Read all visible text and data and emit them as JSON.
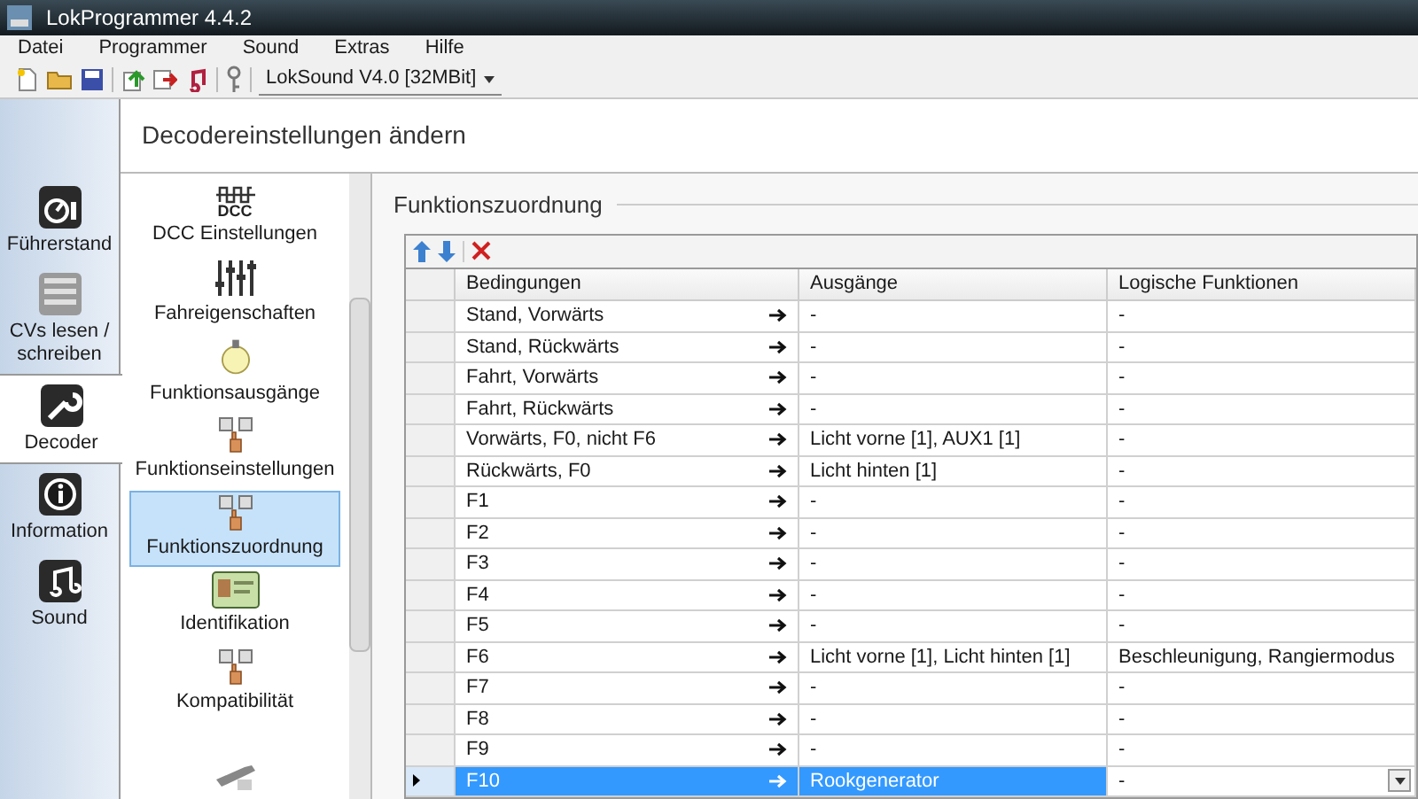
{
  "window": {
    "title": "LokProgrammer 4.4.2"
  },
  "menu": [
    "Datei",
    "Programmer",
    "Sound",
    "Extras",
    "Hilfe"
  ],
  "toolbar": {
    "decoder_select": "LokSound V4.0 [32MBit]"
  },
  "nav": [
    {
      "label": "Führerstand",
      "kind": "gauge",
      "selected": false
    },
    {
      "label": "CVs lesen / schreiben",
      "kind": "binary",
      "selected": false
    },
    {
      "label": "Decoder",
      "kind": "wrench",
      "selected": true
    },
    {
      "label": "Information",
      "kind": "info",
      "selected": false
    },
    {
      "label": "Sound",
      "kind": "music",
      "selected": false
    }
  ],
  "page_title": "Decodereinstellungen ändern",
  "sections": [
    {
      "label": "DCC Einstellungen",
      "kind": "dcc",
      "icon_text": "DCC",
      "selected": false
    },
    {
      "label": "Fahreigenschaften",
      "kind": "sliders",
      "selected": false
    },
    {
      "label": "Funktionsausgänge",
      "kind": "bulb",
      "selected": false
    },
    {
      "label": "Funktionseinstellungen",
      "kind": "hand",
      "selected": false
    },
    {
      "label": "Funktionszuordnung",
      "kind": "hand",
      "selected": true
    },
    {
      "label": "Identifikation",
      "kind": "card",
      "selected": false
    },
    {
      "label": "Kompatibilität",
      "kind": "hand",
      "selected": false
    },
    {
      "kind": "tool",
      "selected": false
    }
  ],
  "panel_title": "Funktionszuordnung",
  "table": {
    "columns": [
      "Bedingungen",
      "Ausgänge",
      "Logische Funktionen"
    ],
    "rows": [
      {
        "condition": "Stand, Vorwärts",
        "outputs": "-",
        "logic": "-",
        "selected": false
      },
      {
        "condition": "Stand, Rückwärts",
        "outputs": "-",
        "logic": "-",
        "selected": false
      },
      {
        "condition": "Fahrt, Vorwärts",
        "outputs": "-",
        "logic": "-",
        "selected": false
      },
      {
        "condition": "Fahrt, Rückwärts",
        "outputs": "-",
        "logic": "-",
        "selected": false
      },
      {
        "condition": "Vorwärts, F0, nicht F6",
        "outputs": "Licht vorne [1], AUX1 [1]",
        "logic": "-",
        "selected": false
      },
      {
        "condition": "Rückwärts, F0",
        "outputs": "Licht hinten [1]",
        "logic": "-",
        "selected": false
      },
      {
        "condition": "F1",
        "outputs": "-",
        "logic": "-",
        "selected": false
      },
      {
        "condition": "F2",
        "outputs": "-",
        "logic": "-",
        "selected": false
      },
      {
        "condition": "F3",
        "outputs": "-",
        "logic": "-",
        "selected": false
      },
      {
        "condition": "F4",
        "outputs": "-",
        "logic": "-",
        "selected": false
      },
      {
        "condition": "F5",
        "outputs": "-",
        "logic": "-",
        "selected": false
      },
      {
        "condition": "F6",
        "outputs": "Licht vorne [1], Licht hinten [1]",
        "logic": "Beschleunigung, Rangiermodus",
        "selected": false
      },
      {
        "condition": "F7",
        "outputs": "-",
        "logic": "-",
        "selected": false
      },
      {
        "condition": "F8",
        "outputs": "-",
        "logic": "-",
        "selected": false
      },
      {
        "condition": "F9",
        "outputs": "-",
        "logic": "-",
        "selected": false
      },
      {
        "condition": "F10",
        "outputs": "Rookgenerator",
        "logic": "-",
        "selected": true
      }
    ]
  }
}
